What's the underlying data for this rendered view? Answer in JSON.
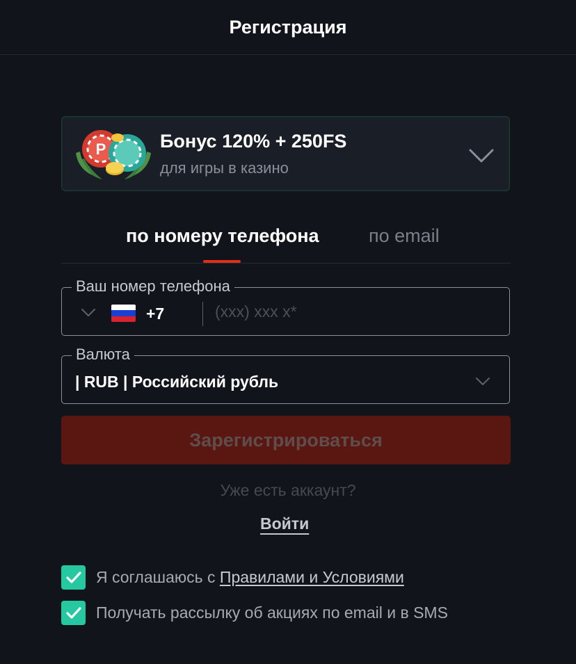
{
  "header": {
    "title": "Регистрация"
  },
  "bonus": {
    "title": "Бонус 120% + 250FS",
    "subtitle": "для игры в казино",
    "art_icon": "casino-chips-wreath-icon",
    "chevron_icon": "chevron-down-icon"
  },
  "tabs": [
    {
      "label": "по номеру телефона",
      "active": true
    },
    {
      "label": "по email",
      "active": false
    }
  ],
  "phone": {
    "label": "Ваш номер телефона",
    "country_flag": "russia-flag-icon",
    "code": "+7",
    "placeholder": "(xxx) xxx x*",
    "value": ""
  },
  "currency": {
    "label": "Валюта",
    "value": "| RUB | Российский рубль"
  },
  "submit": {
    "label": "Зарегистрироваться"
  },
  "login": {
    "prompt": "Уже есть аккаунт?",
    "link": "Войти"
  },
  "consents": [
    {
      "checked": true,
      "text": "Я соглашаюсь с ",
      "link": "Правилами и Условиями"
    },
    {
      "checked": true,
      "text": "Получать рассылку об акциях по email и в SMS"
    }
  ],
  "colors": {
    "background": "#11141b",
    "accent_red": "#e42f17",
    "button_disabled": "#5a1712",
    "checkbox": "#25c8a0",
    "bonus_border": "#1d3b35"
  }
}
